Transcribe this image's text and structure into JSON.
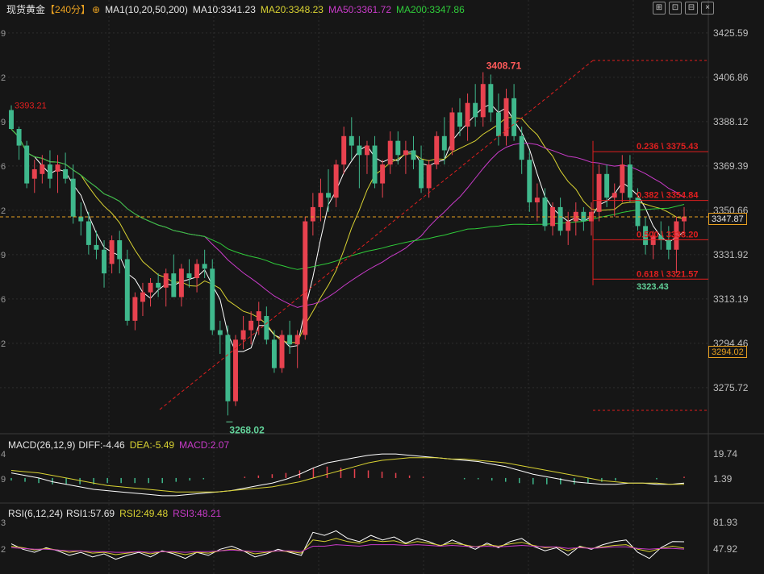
{
  "legend_main": {
    "symbol": "现货黄金",
    "period": "【240分】",
    "ma_params": "MA1(10,20,50,200)",
    "ma10": "MA10:3341.23",
    "ma20": "MA20:3348.23",
    "ma50": "MA50:3361.72",
    "ma200": "MA200:3347.86"
  },
  "legend_macd": {
    "title": "MACD(26,12,9)",
    "diff": "DIFF:-4.46",
    "dea": "DEA:-5.49",
    "macd": "MACD:2.07"
  },
  "legend_rsi": {
    "title": "RSI(6,12,24)",
    "rsi1": "RSI1:57.69",
    "rsi2": "RSI2:49.48",
    "rsi3": "RSI3:48.21"
  },
  "toolbar": {
    "icons": [
      "crosshair-icon",
      "fullscreen-icon",
      "split-view-icon",
      "close-icon"
    ],
    "glyphs": [
      "⊞",
      "⊡",
      "⊟",
      "×"
    ]
  },
  "price_axis": {
    "ticks": [
      "3425.59",
      "3406.86",
      "3388.12",
      "3369.39",
      "3350.66",
      "3331.92",
      "3313.19",
      "3294.46",
      "3275.72"
    ],
    "current_tag": "3347.87",
    "low_tag": "3294.02"
  },
  "left_axis_partial": [
    "9",
    "2",
    "9",
    "6",
    "2",
    "9",
    "6",
    "2"
  ],
  "macd_axis": {
    "ticks": [
      "19.74",
      "1.39"
    ],
    "left_partial": [
      "4",
      "9"
    ]
  },
  "rsi_axis": {
    "ticks": [
      "81.93",
      "47.92"
    ],
    "left_partial": [
      "3",
      "2"
    ]
  },
  "annotations": {
    "high": "3408.71",
    "low": "3268.02",
    "left_start": "3393.21",
    "last_low": "3323.43"
  },
  "fibonacci": {
    "levels": [
      {
        "label": "0.236 \\ 3375.43",
        "price": 3375.43
      },
      {
        "label": "0.382 \\ 3354.84",
        "price": 3354.84
      },
      {
        "label": "0.500 \\ 3338.20",
        "price": 3338.2
      },
      {
        "label": "0.618 \\ 3321.57",
        "price": 3321.57
      }
    ]
  },
  "colors": {
    "background": "#161616",
    "grid": "#2c2c2c",
    "up": "#e8424f",
    "down": "#3fb88c",
    "ma10": "#ffffff",
    "ma20": "#d9d232",
    "ma50": "#c93bc9",
    "ma200": "#2fcc3a",
    "fib": "#e01f1f",
    "price_line": "#e8a020",
    "label_green": "#62d39a"
  },
  "chart_data": [
    {
      "type": "candlestick",
      "title": "现货黄金【240分】",
      "ylim": [
        3259,
        3432
      ],
      "y_ticks": [
        3425.59,
        3406.86,
        3388.12,
        3369.39,
        3350.66,
        3331.92,
        3313.19,
        3294.46,
        3275.72
      ],
      "current_price": 3347.87,
      "candles": [
        [
          3393,
          3395,
          3385,
          3385
        ],
        [
          3385,
          3386,
          3372,
          3378
        ],
        [
          3378,
          3380,
          3360,
          3362
        ],
        [
          3364,
          3372,
          3358,
          3368
        ],
        [
          3366,
          3374,
          3362,
          3370
        ],
        [
          3370,
          3376,
          3360,
          3364
        ],
        [
          3367,
          3374,
          3358,
          3370
        ],
        [
          3368,
          3375,
          3362,
          3364
        ],
        [
          3364,
          3370,
          3345,
          3348
        ],
        [
          3348,
          3354,
          3340,
          3346
        ],
        [
          3346,
          3350,
          3332,
          3336
        ],
        [
          3336,
          3342,
          3330,
          3334
        ],
        [
          3334,
          3338,
          3318,
          3324
        ],
        [
          3328,
          3340,
          3324,
          3338
        ],
        [
          3338,
          3342,
          3324,
          3330
        ],
        [
          3330,
          3334,
          3302,
          3304
        ],
        [
          3304,
          3316,
          3300,
          3314
        ],
        [
          3312,
          3320,
          3306,
          3316
        ],
        [
          3316,
          3322,
          3310,
          3320
        ],
        [
          3320,
          3324,
          3314,
          3318
        ],
        [
          3318,
          3326,
          3310,
          3324
        ],
        [
          3324,
          3332,
          3316,
          3314
        ],
        [
          3314,
          3328,
          3310,
          3326
        ],
        [
          3324,
          3330,
          3318,
          3322
        ],
        [
          3322,
          3330,
          3316,
          3328
        ],
        [
          3328,
          3334,
          3322,
          3326
        ],
        [
          3326,
          3330,
          3298,
          3300
        ],
        [
          3300,
          3304,
          3290,
          3298
        ],
        [
          3298,
          3302,
          3264,
          3270
        ],
        [
          3270,
          3298,
          3268,
          3296
        ],
        [
          3296,
          3306,
          3292,
          3300
        ],
        [
          3300,
          3308,
          3294,
          3304
        ],
        [
          3304,
          3312,
          3298,
          3308
        ],
        [
          3306,
          3310,
          3294,
          3296
        ],
        [
          3296,
          3300,
          3282,
          3284
        ],
        [
          3284,
          3300,
          3282,
          3298
        ],
        [
          3298,
          3304,
          3290,
          3294
        ],
        [
          3294,
          3300,
          3284,
          3298
        ],
        [
          3298,
          3348,
          3296,
          3346
        ],
        [
          3346,
          3358,
          3340,
          3352
        ],
        [
          3352,
          3364,
          3346,
          3358
        ],
        [
          3358,
          3368,
          3350,
          3356
        ],
        [
          3356,
          3372,
          3352,
          3370
        ],
        [
          3370,
          3386,
          3366,
          3382
        ],
        [
          3382,
          3390,
          3372,
          3378
        ],
        [
          3378,
          3382,
          3360,
          3374
        ],
        [
          3374,
          3380,
          3366,
          3378
        ],
        [
          3378,
          3382,
          3360,
          3362
        ],
        [
          3362,
          3372,
          3356,
          3370
        ],
        [
          3370,
          3384,
          3366,
          3380
        ],
        [
          3380,
          3384,
          3370,
          3374
        ],
        [
          3374,
          3380,
          3366,
          3376
        ],
        [
          3376,
          3382,
          3368,
          3372
        ],
        [
          3372,
          3378,
          3358,
          3360
        ],
        [
          3360,
          3372,
          3356,
          3370
        ],
        [
          3370,
          3384,
          3368,
          3382
        ],
        [
          3382,
          3390,
          3370,
          3376
        ],
        [
          3376,
          3394,
          3374,
          3392
        ],
        [
          3392,
          3398,
          3382,
          3386
        ],
        [
          3386,
          3400,
          3380,
          3396
        ],
        [
          3396,
          3404,
          3386,
          3390
        ],
        [
          3390,
          3409,
          3386,
          3404
        ],
        [
          3404,
          3408,
          3388,
          3392
        ],
        [
          3392,
          3400,
          3378,
          3382
        ],
        [
          3382,
          3402,
          3378,
          3398
        ],
        [
          3398,
          3404,
          3380,
          3382
        ],
        [
          3382,
          3386,
          3366,
          3372
        ],
        [
          3372,
          3376,
          3350,
          3354
        ],
        [
          3354,
          3362,
          3346,
          3356
        ],
        [
          3356,
          3360,
          3342,
          3344
        ],
        [
          3344,
          3354,
          3340,
          3352
        ],
        [
          3352,
          3356,
          3340,
          3342
        ],
        [
          3342,
          3350,
          3336,
          3346
        ],
        [
          3346,
          3354,
          3340,
          3350
        ],
        [
          3350,
          3352,
          3342,
          3346
        ],
        [
          3346,
          3354,
          3340,
          3350
        ],
        [
          3350,
          3370,
          3346,
          3366
        ],
        [
          3366,
          3370,
          3352,
          3356
        ],
        [
          3356,
          3362,
          3348,
          3358
        ],
        [
          3358,
          3374,
          3354,
          3370
        ],
        [
          3370,
          3374,
          3354,
          3356
        ],
        [
          3356,
          3360,
          3342,
          3344
        ],
        [
          3344,
          3348,
          3332,
          3336
        ],
        [
          3336,
          3342,
          3330,
          3340
        ],
        [
          3340,
          3346,
          3334,
          3338
        ],
        [
          3338,
          3344,
          3330,
          3334
        ],
        [
          3334,
          3348,
          3324,
          3346
        ],
        [
          3346,
          3352,
          3340,
          3348
        ]
      ]
    },
    {
      "type": "line",
      "title": "MACD(26,12,9)",
      "series": [
        {
          "name": "DIFF",
          "values": [
            4,
            2,
            0,
            -3,
            -5,
            -7,
            -9,
            -10,
            -11,
            -12,
            -13,
            -14,
            -14,
            -13,
            -12,
            -11,
            -10,
            -8,
            -6,
            -4,
            -1,
            3,
            8,
            12,
            14,
            16,
            18,
            19,
            19,
            18,
            17,
            16,
            15,
            14,
            13,
            11,
            9,
            6,
            3,
            1,
            -1,
            -3,
            -4,
            -5,
            -5,
            -4,
            -4,
            -5,
            -5,
            -4
          ]
        },
        {
          "name": "DEA",
          "values": [
            6,
            5,
            4,
            2,
            0,
            -2,
            -4,
            -6,
            -7,
            -8,
            -9,
            -10,
            -11,
            -11,
            -11,
            -11,
            -10,
            -9,
            -8,
            -7,
            -5,
            -3,
            0,
            3,
            6,
            9,
            12,
            14,
            15,
            16,
            16,
            16,
            15,
            15,
            14,
            13,
            12,
            10,
            8,
            6,
            4,
            2,
            0,
            -2,
            -3,
            -4,
            -4,
            -4,
            -5,
            -5
          ]
        },
        {
          "name": "MACD",
          "values": [
            -2,
            -3,
            -4,
            -5,
            -5,
            -5,
            -5,
            -4,
            -4,
            -4,
            -4,
            -4,
            -3,
            -2,
            -1,
            0,
            0,
            1,
            2,
            3,
            4,
            6,
            8,
            9,
            8,
            7,
            6,
            5,
            4,
            2,
            1,
            0,
            0,
            -1,
            -1,
            -2,
            -3,
            -4,
            -5,
            -5,
            -5,
            -5,
            -4,
            -3,
            -2,
            0,
            0,
            -1,
            0,
            1
          ]
        }
      ]
    },
    {
      "type": "line",
      "title": "RSI(6,12,24)",
      "series": [
        {
          "name": "RSI1",
          "values": [
            55,
            48,
            44,
            50,
            46,
            40,
            44,
            38,
            42,
            35,
            40,
            44,
            38,
            46,
            42,
            36,
            44,
            40,
            48,
            52,
            46,
            38,
            42,
            48,
            44,
            40,
            70,
            66,
            72,
            62,
            58,
            66,
            60,
            64,
            56,
            62,
            58,
            52,
            60,
            54,
            48,
            56,
            50,
            58,
            62,
            52,
            46,
            50,
            40,
            52,
            48,
            54,
            58,
            60,
            44,
            36,
            50,
            58,
            57.69
          ]
        },
        {
          "name": "RSI2",
          "values": [
            52,
            50,
            47,
            49,
            47,
            44,
            46,
            43,
            44,
            41,
            43,
            45,
            42,
            45,
            44,
            41,
            44,
            43,
            46,
            48,
            46,
            42,
            44,
            46,
            45,
            43,
            60,
            58,
            62,
            58,
            56,
            60,
            58,
            59,
            55,
            58,
            56,
            53,
            56,
            54,
            51,
            54,
            52,
            55,
            57,
            53,
            50,
            51,
            46,
            51,
            49,
            51,
            53,
            54,
            48,
            45,
            49,
            52,
            49.48
          ]
        },
        {
          "name": "RSI3",
          "values": [
            50,
            49,
            48,
            48,
            47,
            46,
            46,
            45,
            45,
            44,
            44,
            45,
            44,
            45,
            45,
            44,
            45,
            45,
            46,
            47,
            46,
            45,
            45,
            46,
            46,
            45,
            52,
            52,
            54,
            53,
            52,
            54,
            54,
            54,
            53,
            54,
            53,
            52,
            53,
            52,
            51,
            52,
            51,
            52,
            53,
            52,
            51,
            51,
            49,
            50,
            49,
            50,
            51,
            51,
            49,
            48,
            49,
            49,
            48.21
          ]
        }
      ]
    }
  ]
}
